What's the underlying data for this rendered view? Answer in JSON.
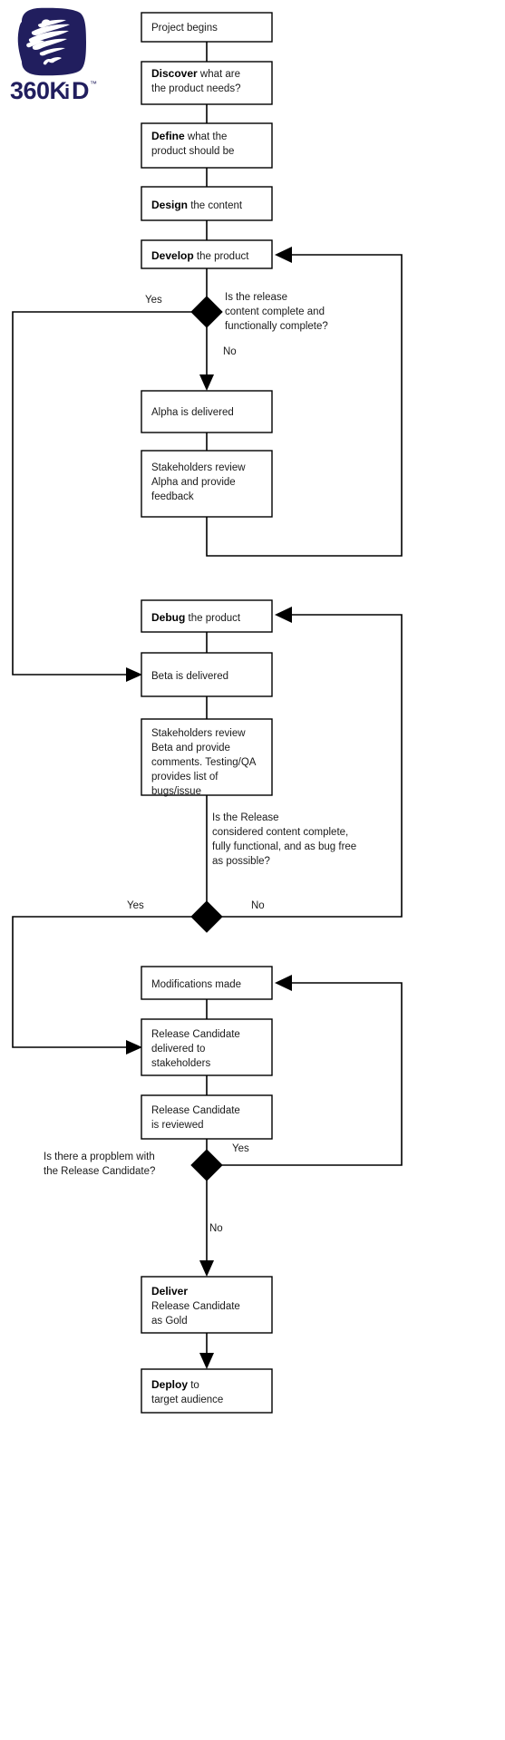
{
  "logo": {
    "name": "360KiD",
    "wordmark": "360KiD",
    "trademark": "™",
    "brand_color": "#211e5e",
    "mark_fill": "#211e5e",
    "scribble_color": "#ffffff"
  },
  "diagram": {
    "title": "Project development process flowchart",
    "line_color": "#000000",
    "box_fill": "#ffffff",
    "text_color": "#1a1a1a"
  },
  "nodes": {
    "project_begins": {
      "text": "Project begins"
    },
    "discover": {
      "bold": "Discover",
      "rest": " what are",
      "line2": "the product needs?"
    },
    "define": {
      "bold": "Define",
      "rest": " what the",
      "line2": "product should be"
    },
    "design": {
      "bold": "Design",
      "rest": " the content"
    },
    "develop": {
      "bold": "Develop",
      "rest": " the product"
    },
    "alpha_delivered": {
      "text": "Alpha is delivered"
    },
    "stakeholders_alpha": {
      "line1": "Stakeholders review",
      "line2": "Alpha and provide",
      "line3": "feedback"
    },
    "debug": {
      "bold": "Debug",
      "rest": " the product"
    },
    "beta_delivered": {
      "text": "Beta is delivered"
    },
    "stakeholders_beta": {
      "line1": "Stakeholders review",
      "line2": "Beta and provide",
      "line3": "comments. Testing/QA",
      "line4": "provides list of",
      "line5": "bugs/issue"
    },
    "modifications": {
      "text": "Modifications made"
    },
    "rc_delivered": {
      "line1": "Release Candidate",
      "line2": "delivered to",
      "line3": "stakeholders"
    },
    "rc_reviewed": {
      "line1": "Release Candidate",
      "line2": "is reviewed"
    },
    "deliver": {
      "bold": "Deliver",
      "line2": "Release Candidate",
      "line3": "as Gold"
    },
    "deploy": {
      "bold": "Deploy",
      "rest": " to",
      "line2": "target audience"
    }
  },
  "decisions": {
    "d1": {
      "question_l1": "Is the release",
      "question_l2": "content complete and",
      "question_l3": "functionally complete?",
      "yes_label": "Yes",
      "no_label": "No"
    },
    "d2": {
      "question_l1": "Is the Release",
      "question_l2": "considered content complete,",
      "question_l3": "fully functional, and as bug free",
      "question_l4": "as possible?",
      "yes_label": "Yes",
      "no_label": "No"
    },
    "d3": {
      "question_l1": "Is there a propblem with",
      "question_l2": "the Release Candidate?",
      "yes_label": "Yes",
      "no_label": "No"
    }
  }
}
